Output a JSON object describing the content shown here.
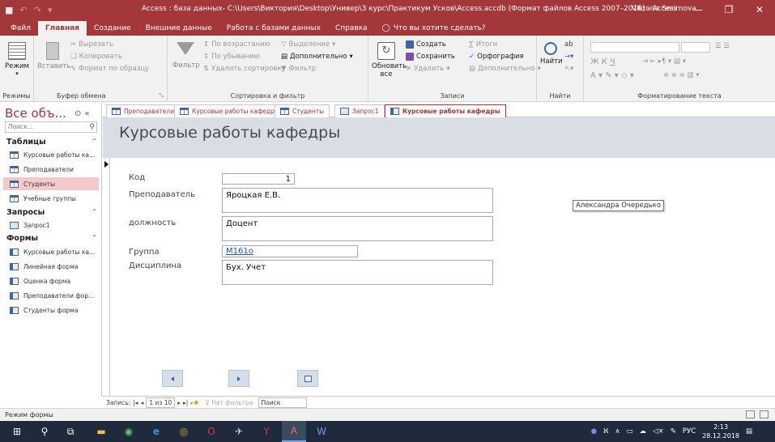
{
  "window": {
    "title": "Access : база данных- C:\\Users\\Виктория\\Desktop\\Универ\\3 курс\\Практикум Усков\\Access.accdb (Формат файлов Access 2007–2016)  -  Access",
    "user": "Viktoria Smirnova"
  },
  "ribbon_tabs": {
    "file": "Файл",
    "home": "Главная",
    "create": "Создание",
    "external": "Внешние данные",
    "database": "Работа с базами данных",
    "help": "Справка",
    "tell": "Что вы хотите сделать?"
  },
  "ribbon": {
    "views": {
      "mode": "Режим",
      "label": "Режимы"
    },
    "clipboard": {
      "paste": "Вставить",
      "cut": "Вырезать",
      "copy": "Копировать",
      "format_painter": "Формат по образцу",
      "label": "Буфер обмена"
    },
    "sort": {
      "filter": "Фильтр",
      "asc": "По возрастанию",
      "desc": "По убыванию",
      "remove_sort": "Удалить сортировку",
      "selection": "Выделение",
      "advanced": "Дополнительно",
      "toggle_filter": "Фильтр",
      "label": "Сортировка и фильтр"
    },
    "records": {
      "refresh": "Обновить",
      "refresh2": "все",
      "new": "Создать",
      "save": "Сохранить",
      "delete": "Удалить",
      "totals": "Итоги",
      "spelling": "Орфография",
      "more": "Дополнительно",
      "label": "Записи"
    },
    "find": {
      "find": "Найти",
      "label": "Найти"
    },
    "text": {
      "label": "Форматирование текста"
    }
  },
  "nav": {
    "title": "Все объ...",
    "search_placeholder": "Поиск...",
    "groups": {
      "tables": "Таблицы",
      "queries": "Запросы",
      "forms": "Формы"
    },
    "tables": [
      "Курсовые работы ка...",
      "Преподаватели",
      "Студенты",
      "Учебные группы"
    ],
    "queries": [
      "Запрос1"
    ],
    "forms": [
      "Курсовые работы ка...",
      "Линейная форма",
      "Оценка форма",
      "Преподаватели фор...",
      "Студенты форма"
    ]
  },
  "doc_tabs": [
    "Преподаватели",
    "Курсовые работы кафедры",
    "Студенты",
    "Запрос1",
    "Курсовые работы кафедры"
  ],
  "form": {
    "title": "Курсовые работы кафедры",
    "labels": {
      "code": "Код",
      "teacher": "Преподаватель",
      "position": "должность",
      "group": "Группа",
      "discipline": "Дисциплина"
    },
    "values": {
      "code": "1",
      "teacher": "Яроцкая Е.В.",
      "position": "Доцент",
      "group": "М161о",
      "discipline": "Бух. Учет"
    },
    "tooltip": "Александра Очередько"
  },
  "record_nav": {
    "prefix": "Запись:",
    "position": "1 из 10",
    "no_filter": "Нет фильтра",
    "search": "Поиск"
  },
  "status": {
    "text": "Режим формы"
  },
  "taskbar": {
    "lang": "РУС",
    "time": "2:13",
    "date": "28.12.2018"
  }
}
